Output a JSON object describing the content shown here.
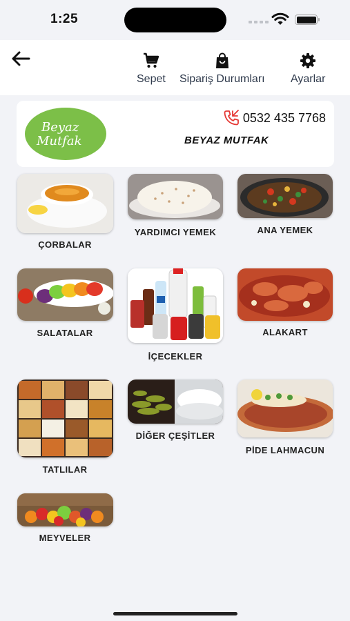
{
  "status_bar": {
    "time": "1:25"
  },
  "app_bar": {
    "cart_label": "Sepet",
    "orders_label": "Sipariş Durumları",
    "settings_label": "Ayarlar"
  },
  "store": {
    "logo_line1": "Beyaz",
    "logo_line2": "Mutfak",
    "phone": "0532 435 7768",
    "name": "BEYAZ MUTFAK"
  },
  "categories": [
    {
      "label": "ÇORBALAR"
    },
    {
      "label": "YARDIMCI YEMEK"
    },
    {
      "label": "ANA YEMEK"
    },
    {
      "label": "SALATALAR"
    },
    {
      "label": "İÇECEKLER"
    },
    {
      "label": "ALAKART"
    },
    {
      "label": "TATLILAR"
    },
    {
      "label": "DİĞER ÇEŞİTLER"
    },
    {
      "label": "PİDE LAHMACUN"
    },
    {
      "label": "MEYVELER"
    }
  ],
  "colors": {
    "accent": "#7cbf48",
    "phone_icon": "#e53935",
    "background": "#f2f3f7"
  }
}
